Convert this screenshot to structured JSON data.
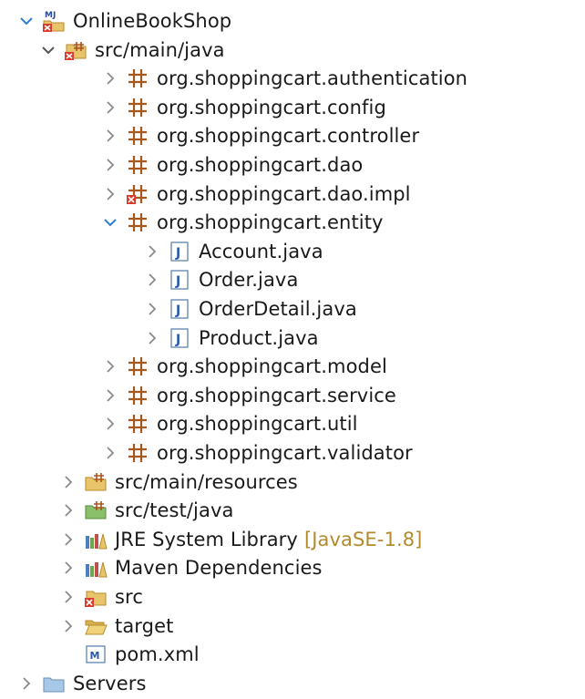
{
  "tree": {
    "project": {
      "label": "OnlineBookShop",
      "icon": "maven-project-error-icon"
    },
    "src_main_java": {
      "label": "src/main/java",
      "icon": "source-folder-error-icon"
    },
    "packages_before": [
      {
        "label": "org.shoppingcart.authentication",
        "icon": "package-icon"
      },
      {
        "label": "org.shoppingcart.config",
        "icon": "package-icon"
      },
      {
        "label": "org.shoppingcart.controller",
        "icon": "package-icon"
      },
      {
        "label": "org.shoppingcart.dao",
        "icon": "package-icon"
      },
      {
        "label": "org.shoppingcart.dao.impl",
        "icon": "package-error-icon"
      }
    ],
    "entity_package": {
      "label": "org.shoppingcart.entity",
      "icon": "package-icon"
    },
    "entity_files": [
      {
        "label": "Account.java",
        "icon": "java-file-icon"
      },
      {
        "label": "Order.java",
        "icon": "java-file-icon"
      },
      {
        "label": "OrderDetail.java",
        "icon": "java-file-icon"
      },
      {
        "label": "Product.java",
        "icon": "java-file-icon"
      }
    ],
    "packages_after": [
      {
        "label": "org.shoppingcart.model",
        "icon": "package-icon"
      },
      {
        "label": "org.shoppingcart.service",
        "icon": "package-icon"
      },
      {
        "label": "org.shoppingcart.util",
        "icon": "package-icon"
      },
      {
        "label": "org.shoppingcart.validator",
        "icon": "package-icon"
      }
    ],
    "project_children": [
      {
        "label": "src/main/resources",
        "icon": "resource-folder-icon"
      },
      {
        "label": "src/test/java",
        "icon": "test-source-folder-icon"
      },
      {
        "label": "JRE System Library",
        "decoration": "[JavaSE-1.8]",
        "icon": "library-icon"
      },
      {
        "label": "Maven Dependencies",
        "icon": "library-icon"
      },
      {
        "label": "src",
        "icon": "folder-error-icon"
      },
      {
        "label": "target",
        "icon": "folder-open-icon"
      },
      {
        "label": "pom.xml",
        "icon": "maven-pom-icon"
      }
    ],
    "servers": {
      "label": "Servers",
      "icon": "folder-icon"
    }
  },
  "colors": {
    "text": "#1a1a1a",
    "chevron": "#8a8a8a",
    "chevron_expanded": "#2c7fd0",
    "package": "#a8561b",
    "folder": "#e8c46a",
    "error": "#d93a2b",
    "decoration": "#b38a2e"
  }
}
